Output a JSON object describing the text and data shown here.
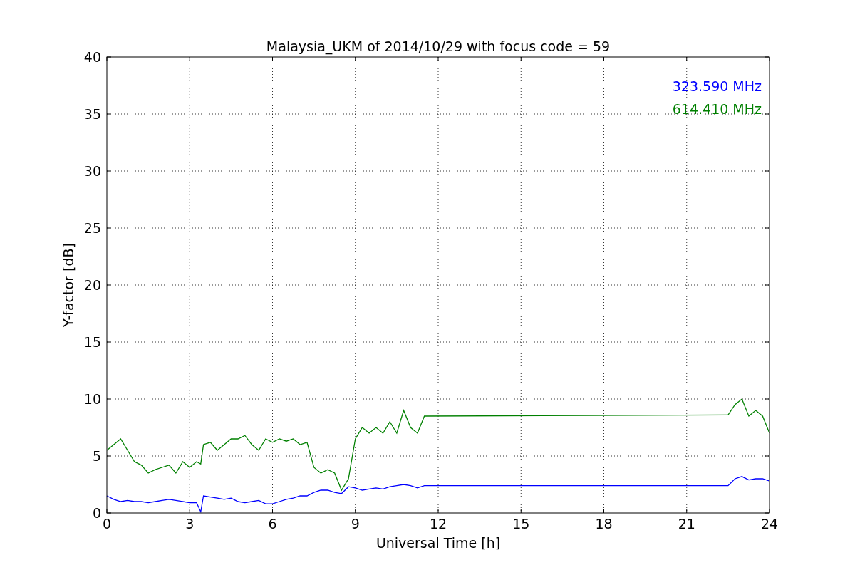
{
  "figure": {
    "chart_data": {
      "type": "line",
      "title": "Malaysia_UKM of 2014/10/29 with focus code = 59",
      "xlabel": "Universal Time [h]",
      "ylabel": "Y-factor [dB]",
      "x": [
        0,
        0.25,
        0.5,
        0.75,
        1,
        1.25,
        1.5,
        1.75,
        2,
        2.25,
        2.5,
        2.75,
        3,
        3.25,
        3.4,
        3.5,
        3.75,
        4,
        4.25,
        4.5,
        4.75,
        5,
        5.25,
        5.5,
        5.75,
        6,
        6.25,
        6.5,
        6.75,
        7,
        7.25,
        7.5,
        7.75,
        8,
        8.25,
        8.5,
        8.75,
        9,
        9.25,
        9.5,
        9.75,
        10,
        10.25,
        10.5,
        10.75,
        11,
        11.25,
        11.5,
        22.5,
        22.75,
        23,
        23.25,
        23.5,
        23.75,
        24
      ],
      "series": [
        {
          "name": "323.590 MHz",
          "color": "#0000ff",
          "values": [
            1.5,
            1.2,
            1,
            1.1,
            1,
            1,
            0.9,
            1,
            1.1,
            1.2,
            1.1,
            1,
            0.9,
            0.9,
            0.1,
            1.5,
            1.4,
            1.3,
            1.2,
            1.3,
            1,
            0.9,
            1,
            1.1,
            0.8,
            0.8,
            1,
            1.2,
            1.3,
            1.5,
            1.5,
            1.8,
            2,
            2,
            1.8,
            1.7,
            2.3,
            2.2,
            2,
            2.1,
            2.2,
            2.1,
            2.3,
            2.4,
            2.5,
            2.4,
            2.2,
            2.4,
            2.4,
            3,
            3.2,
            2.9,
            3,
            3,
            2.8
          ]
        },
        {
          "name": "614.410 MHz",
          "color": "#008000",
          "values": [
            5.5,
            6,
            6.5,
            5.5,
            4.5,
            4.2,
            3.5,
            3.8,
            4,
            4.2,
            3.5,
            4.5,
            4,
            4.5,
            4.3,
            6,
            6.2,
            5.5,
            6,
            6.5,
            6.5,
            6.8,
            6,
            5.5,
            6.5,
            6.2,
            6.5,
            6.3,
            6.5,
            6,
            6.2,
            4,
            3.5,
            3.8,
            3.5,
            2,
            3,
            6.5,
            7.5,
            7,
            7.5,
            7,
            8,
            7,
            9,
            7.5,
            7,
            8.5,
            8.6,
            9.5,
            10,
            8.5,
            9,
            8.5,
            7
          ]
        }
      ],
      "grid": true,
      "xlim": [
        0,
        24
      ],
      "ylim": [
        0,
        40
      ],
      "xticks": [
        0,
        3,
        6,
        9,
        12,
        15,
        18,
        21,
        24
      ],
      "yticks": [
        0,
        5,
        10,
        15,
        20,
        25,
        30,
        35,
        40
      ]
    }
  }
}
